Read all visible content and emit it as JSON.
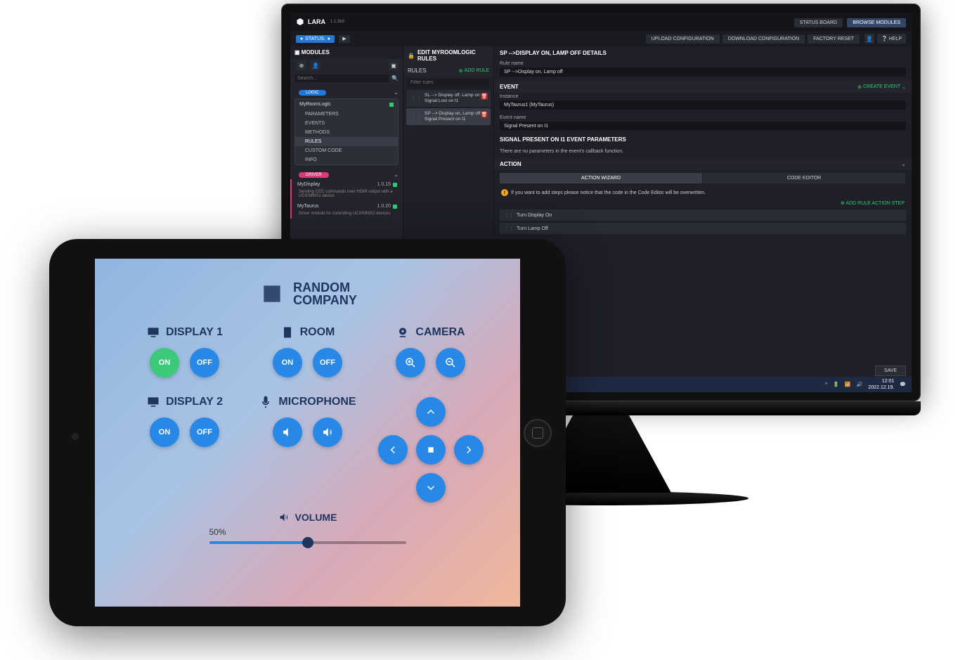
{
  "desktop": {
    "app_name": "LARA",
    "app_version": "1.1.3b3",
    "status_btn": "STATUS:",
    "header_buttons": {
      "status_board": "STATUS BOARD",
      "browse": "BROWSE MODULES"
    },
    "config_bar": {
      "upload": "UPLOAD CONFIGURATION",
      "download": "DOWNLOAD CONFIGURATION",
      "factory": "FACTORY RESET",
      "help": "HELP"
    },
    "modules": {
      "title": "MODULES",
      "search_ph": "Search...",
      "cat_logic": "LOGIC",
      "logic_module": "MyRoomLogic",
      "logic_items": [
        "PARAMETERS",
        "EVENTS",
        "METHODS",
        "RULES",
        "CUSTOM CODE",
        "INFO"
      ],
      "cat_driver": "DRIVER",
      "drivers": [
        {
          "name": "MyDisplay",
          "ver": "1.0.15",
          "desc": "Sending CEC commands over HDMI output with a UCX/MMX2 device"
        },
        {
          "name": "MyTaurus",
          "ver": "1.0.20",
          "desc": "Driver module for controlling UCX/MMX2 devices"
        }
      ]
    },
    "rules": {
      "head": "EDIT MYROOMLOGIC RULES",
      "section": "RULES",
      "add": "ADD RULE",
      "filter_ph": "Filter rules",
      "items": [
        "SL --> Display off, Lamp on Signal Lost on I1",
        "SP --> Display on, Lamp off Signal Present on I1"
      ]
    },
    "detail": {
      "title": "SP -->DISPLAY ON, LAMP OFF DETAILS",
      "rule_name_lbl": "Rule name",
      "rule_name_val": "SP -->Display on, Lamp off",
      "event_head": "EVENT",
      "create_event": "CREATE EVENT",
      "instance_lbl": "Instance",
      "instance_val": "MyTaurus1 (MyTaurus)",
      "eventname_lbl": "Event name",
      "eventname_val": "Signal Present on I1",
      "params_head": "SIGNAL PRESENT ON I1 EVENT PARAMETERS",
      "params_note": "There are no parameters in the event's callback function.",
      "action_head": "ACTION",
      "tab_wizard": "ACTION WIZARD",
      "tab_code": "CODE EDITOR",
      "warn": "If you want to add steps please notice that the code in the Code Editor will be overwritten.",
      "add_step": "ADD RULE ACTION STEP",
      "actions": [
        "Turn Display On",
        "Turn Lamp Off"
      ],
      "save": "SAVE"
    },
    "taskbar": {
      "time": "12:01",
      "date": "2022.12.19."
    }
  },
  "tablet": {
    "company1": "RANDOM",
    "company2": "COMPANY",
    "display1": "DISPLAY 1",
    "display2": "DISPLAY 2",
    "room": "ROOM",
    "microphone": "MICROPHONE",
    "camera": "CAMERA",
    "volume": "VOLUME",
    "on": "ON",
    "off": "OFF",
    "vol_pct": "50%"
  }
}
